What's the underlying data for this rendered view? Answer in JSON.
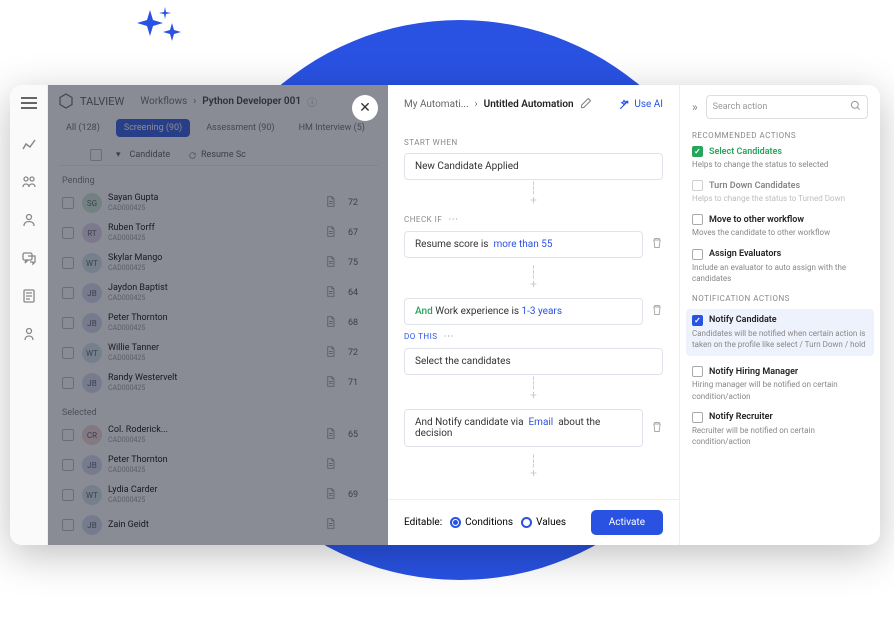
{
  "brand": "TALVIEW",
  "breadcrumbs": {
    "parent": "Workflows",
    "current": "Python Developer 001"
  },
  "tabs": {
    "all": "All (128)",
    "screening": "Screening (90)",
    "assessment": "Assessment (90)",
    "hm": "HM Interview (5)"
  },
  "table": {
    "col1": "Candidate",
    "col2": "Resume Sc"
  },
  "sections": {
    "pending": "Pending",
    "selected": "Selected"
  },
  "rows": [
    {
      "init": "SG",
      "avbg": "#cfe8d6",
      "name": "Sayan Gupta",
      "id": "CAD000425",
      "score": "72"
    },
    {
      "init": "RT",
      "avbg": "#e4d6ef",
      "name": "Ruben Torff",
      "id": "CAD000425",
      "score": "67"
    },
    {
      "init": "WT",
      "avbg": "#d6e4ef",
      "name": "Skylar Mango",
      "id": "CAD000425",
      "score": "75"
    },
    {
      "init": "JB",
      "avbg": "#d6dcef",
      "name": "Jaydon Baptist",
      "id": "CAD000425",
      "score": "64"
    },
    {
      "init": "JB",
      "avbg": "#d6dcef",
      "name": "Peter Thornton",
      "id": "CAD000425",
      "score": "68"
    },
    {
      "init": "WT",
      "avbg": "#d6e4ef",
      "name": "Willie Tanner",
      "id": "CAD000425",
      "score": "72"
    },
    {
      "init": "JB",
      "avbg": "#d6dcef",
      "name": "Randy Westervelt",
      "id": "CAD000425",
      "score": "71"
    },
    {
      "init": "CR",
      "avbg": "#efd6d6",
      "name": "Col. Roderick...",
      "id": "CAD000425",
      "score": "65"
    },
    {
      "init": "JB",
      "avbg": "#d6dcef",
      "name": "Peter Thornton",
      "id": "CAD000425",
      "score": ""
    },
    {
      "init": "WT",
      "avbg": "#d6e4ef",
      "name": "Lydia Carder",
      "id": "CAD000425",
      "score": "69"
    },
    {
      "init": "JB",
      "avbg": "#d6dcef",
      "name": "Zain Geidt",
      "id": "",
      "score": ""
    }
  ],
  "center": {
    "bc_parent": "My Automati...",
    "bc_current": "Untitled Automation",
    "use_ai": "Use AI",
    "start_when_label": "START WHEN",
    "start_when": "New Candidate Applied",
    "check_if_label": "CHECK IF",
    "cond1_pre": "Resume score is",
    "cond1_val": "more than 55",
    "cond2_and": "And",
    "cond2_pre": "Work experience is",
    "cond2_val": "1-3 years",
    "do_this_label": "DO THIS",
    "do1": "Select the candidates",
    "do2_pre": "And Notify candidate via",
    "do2_val": "Email",
    "do2_post": "about the decision",
    "editable": "Editable:",
    "r1": "Conditions",
    "r2": "Values",
    "activate": "Activate"
  },
  "right": {
    "search_ph": "Search action",
    "sec1": "RECOMMENDED ACTIONS",
    "a1_t": "Select Candidates",
    "a1_d": "Helps to change the status to selected",
    "a2_t": "Turn Down Candidates",
    "a2_d": "Helps to change the status to Turned Down",
    "a3_t": "Move to other workflow",
    "a3_d": "Moves the candidate to other workflow",
    "a4_t": "Assign Evaluators",
    "a4_d": "Include an evaluator to auto assign with the candidates",
    "sec2": "NOTIFICATION ACTIONS",
    "a5_t": "Notify Candidate",
    "a5_d": "Candidates will be notified when certain action is taken on the profile like select / Turn Down / hold",
    "a6_t": "Notify Hiring Manager",
    "a6_d": "Hiring manager will be notified on certain condition/action",
    "a7_t": "Notify Recruiter",
    "a7_d": "Recruiter will be notified on certain condition/action"
  }
}
